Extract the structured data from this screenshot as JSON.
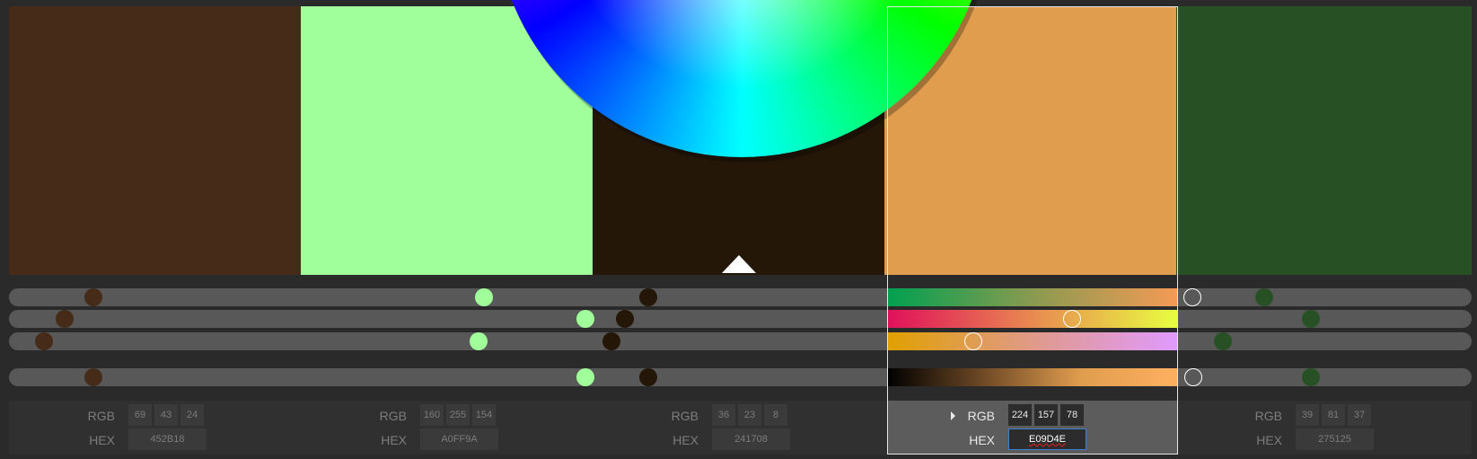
{
  "swatches": [
    {
      "hex_label": "452B18",
      "rgb": [
        "69",
        "43",
        "24"
      ],
      "color": "#452B18",
      "selected": false
    },
    {
      "hex_label": "A0FF9A",
      "rgb": [
        "160",
        "255",
        "154"
      ],
      "color": "#A0FF9A",
      "selected": false
    },
    {
      "hex_label": "241708",
      "rgb": [
        "36",
        "23",
        "8"
      ],
      "color": "#241708",
      "selected": false
    },
    {
      "hex_label": "E09D4E",
      "rgb": [
        "224",
        "157",
        "78"
      ],
      "color": "#E09D4E",
      "selected": true
    },
    {
      "hex_label": "275125",
      "rgb": [
        "39",
        "81",
        "37"
      ],
      "color": "#275125",
      "selected": false
    }
  ],
  "labels": {
    "rgb": "RGB",
    "hex": "HEX"
  },
  "colors": {
    "track": "#585858",
    "panel": "#303030",
    "panel_selected": "#5c5c5c",
    "frame": "#e6e6e6",
    "background": "#2a2a2a"
  },
  "sliders": [
    {
      "name": "hue",
      "values": [
        0.058,
        0.325,
        0.437,
        0.809,
        0.858
      ],
      "active_gradient": "linear-gradient(to right,#00a050,#8a9a50,#f59a55)"
    },
    {
      "name": "saturation",
      "values": [
        0.038,
        0.394,
        0.421,
        0.727,
        0.89
      ],
      "active_gradient": "linear-gradient(to right,#e0105a,#e88a50,#e8ff40)"
    },
    {
      "name": "lightness",
      "values": [
        0.024,
        0.321,
        0.412,
        0.659,
        0.83
      ],
      "active_gradient": "linear-gradient(to right,#e0a000,#e09a8a,#e09aff)"
    },
    {
      "name": "brightness",
      "values": [
        0.058,
        0.394,
        0.437,
        0.81,
        0.89
      ],
      "active_gradient": "linear-gradient(to right,#000000,#704a25,#e09d4e,#ffb060)"
    }
  ],
  "icons": {
    "pointer": "triangle-up-icon",
    "wheel": "color-wheel",
    "expander": "caret-right-icon"
  }
}
